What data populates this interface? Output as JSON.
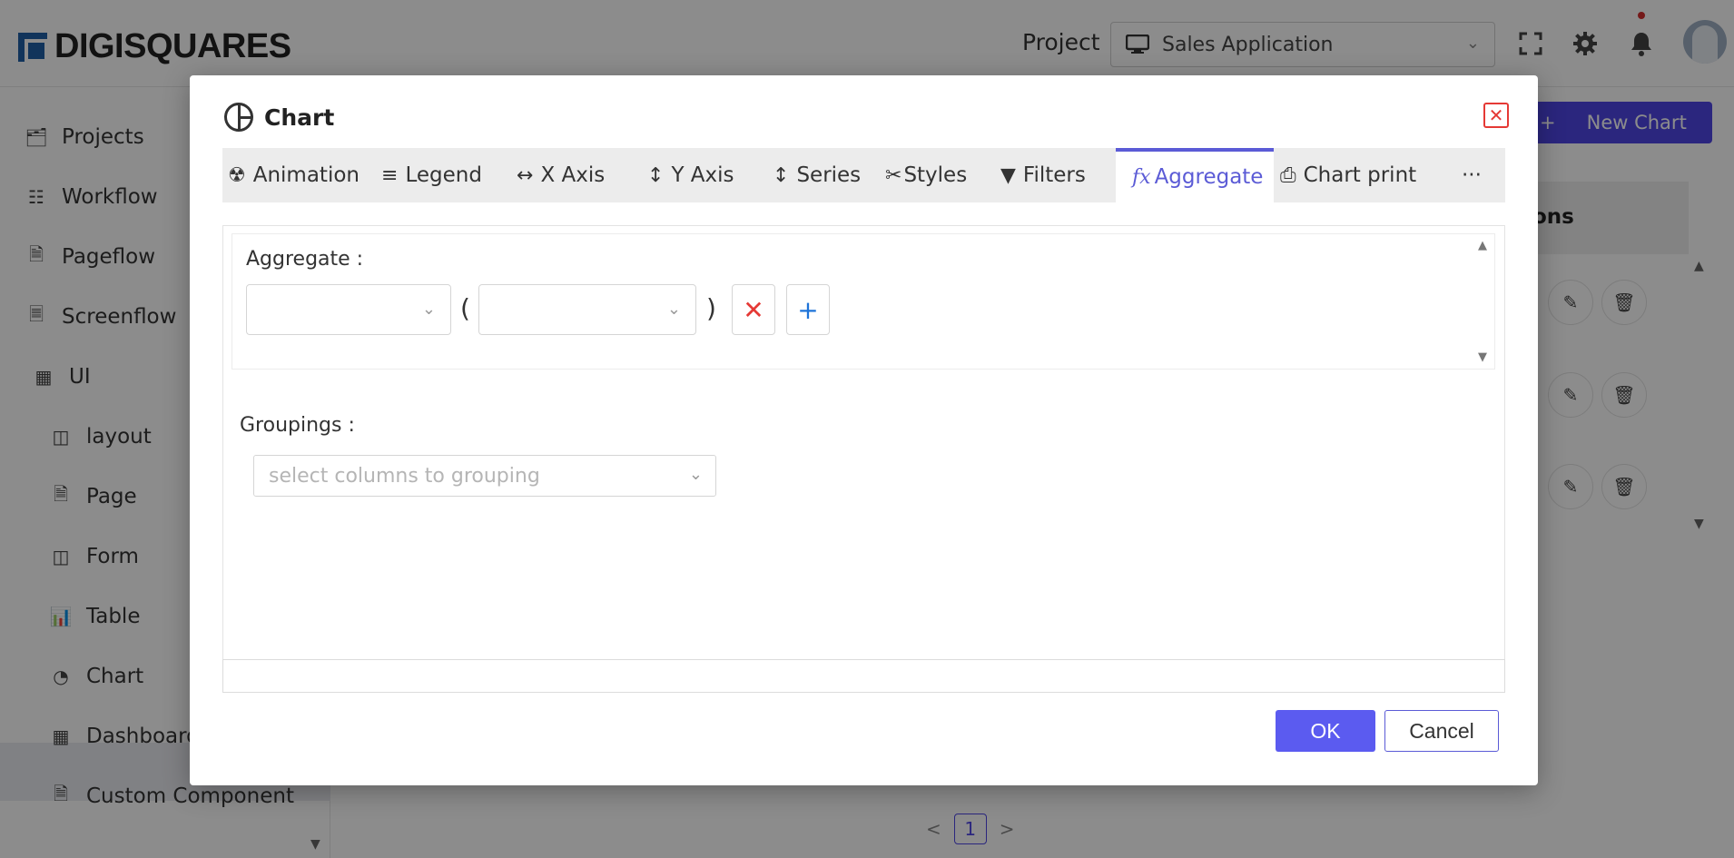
{
  "header": {
    "brand": "DIGISQUARES",
    "project_label": "Project",
    "project_value": "Sales Application"
  },
  "sidebar": {
    "items": [
      {
        "label": "Projects",
        "icon": "folder-open-icon"
      },
      {
        "label": "Workflow",
        "icon": "workflow-icon"
      },
      {
        "label": "Pageflow",
        "icon": "pageflow-icon"
      },
      {
        "label": "Screenflow",
        "icon": "screenflow-icon"
      },
      {
        "label": "UI",
        "icon": "ui-grid-icon"
      },
      {
        "label": "layout",
        "icon": "layout-icon"
      },
      {
        "label": "Page",
        "icon": "page-icon"
      },
      {
        "label": "Form",
        "icon": "form-icon"
      },
      {
        "label": "Table",
        "icon": "table-chart-icon"
      },
      {
        "label": "Chart",
        "icon": "chart-pie-icon",
        "active": true
      },
      {
        "label": "Dashboard",
        "icon": "dashboard-icon"
      },
      {
        "label": "Custom Component",
        "icon": "custom-component-icon"
      }
    ]
  },
  "content": {
    "new_chart_label": "New Chart",
    "table_header_partial": "ons",
    "page_number": "1"
  },
  "modal": {
    "title": "Chart",
    "tabs": [
      {
        "label": "Animation",
        "icon": "radiation-icon"
      },
      {
        "label": "Legend",
        "icon": "lines-icon"
      },
      {
        "label": "X Axis",
        "icon": "horizontal-arrows-icon"
      },
      {
        "label": "Y Axis",
        "icon": "vertical-arrows-icon"
      },
      {
        "label": "Series",
        "icon": "vertical-arrows-icon"
      },
      {
        "label": "Styles",
        "icon": "paint-bucket-icon"
      },
      {
        "label": "Filters",
        "icon": "filter-icon"
      },
      {
        "label": "Aggregate",
        "icon": "fx-icon",
        "active": true
      },
      {
        "label": "Chart print",
        "icon": "printer-icon"
      },
      {
        "label": "···",
        "icon": "more-icon"
      }
    ],
    "aggregate": {
      "label": "Aggregate :",
      "function_value": "",
      "column_value": "",
      "open_paren": "(",
      "close_paren": ")"
    },
    "groupings": {
      "label": "Groupings :",
      "placeholder": "select columns to grouping"
    },
    "ok_label": "OK",
    "cancel_label": "Cancel"
  },
  "colors": {
    "accent": "#5b5bd6",
    "primary_button": "#5b5bf0",
    "danger": "#e53935",
    "add": "#1e73d8"
  }
}
